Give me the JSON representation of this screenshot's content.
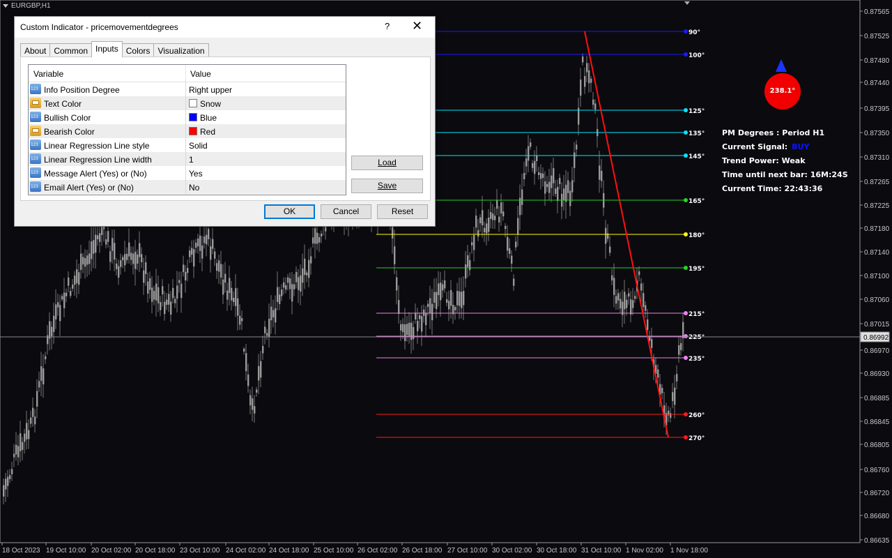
{
  "chart": {
    "symbol": "EURGBP,H1",
    "price_labels": [
      "0.87565",
      "0.87525",
      "0.87480",
      "0.87440",
      "0.87395",
      "0.87350",
      "0.87310",
      "0.87265",
      "0.87225",
      "0.87180",
      "0.87140",
      "0.87100",
      "0.87060",
      "0.87015",
      "0.86992",
      "0.86970",
      "0.86930",
      "0.86885",
      "0.86845",
      "0.86805",
      "0.86760",
      "0.86720",
      "0.86680",
      "0.86635"
    ],
    "current_price": "0.86992",
    "time_labels": [
      "18 Oct 2023",
      "19 Oct 10:00",
      "20 Oct 02:00",
      "20 Oct 18:00",
      "23 Oct 10:00",
      "24 Oct 02:00",
      "24 Oct 18:00",
      "25 Oct 10:00",
      "26 Oct 02:00",
      "26 Oct 18:00",
      "27 Oct 10:00",
      "30 Oct 02:00",
      "30 Oct 18:00",
      "31 Oct 10:00",
      "1 Nov 02:00",
      "1 Nov 18:00"
    ],
    "degree_levels": [
      {
        "label": "90°",
        "color": "#1a1aff"
      },
      {
        "label": "100°",
        "color": "#1a1aff"
      },
      {
        "label": "125°",
        "color": "#00e5ff"
      },
      {
        "label": "135°",
        "color": "#00e5ff"
      },
      {
        "label": "145°",
        "color": "#00e5ff"
      },
      {
        "label": "165°",
        "color": "#22d622"
      },
      {
        "label": "180°",
        "color": "#ffff00"
      },
      {
        "label": "195°",
        "color": "#22d622"
      },
      {
        "label": "215°",
        "color": "#ee82ee"
      },
      {
        "label": "225°",
        "color": "#ee82ee"
      },
      {
        "label": "235°",
        "color": "#ee82ee"
      },
      {
        "label": "260°",
        "color": "#ff1a1a"
      },
      {
        "label": "270°",
        "color": "#ff1a1a"
      }
    ],
    "compass_value": "238.1°",
    "info": {
      "line1": "PM Degrees : Period H1",
      "signal_label": "Current Signal:",
      "signal_value": "BUY",
      "trend": "Trend Power: Weak",
      "next_bar": "Time until next bar: 16M:24S",
      "current_time": "Current Time: 22:43:36"
    }
  },
  "dialog": {
    "title": "Custom Indicator - pricemovementdegrees",
    "help": "?",
    "close": "✕",
    "tabs": [
      "About",
      "Common",
      "Inputs",
      "Colors",
      "Visualization"
    ],
    "header_variable": "Variable",
    "header_value": "Value",
    "rows": [
      {
        "icon": "num",
        "variable": "Info Position Degree",
        "value": "Right upper"
      },
      {
        "icon": "color",
        "variable": "Text Color",
        "value": "Snow",
        "swatch": "#ffffff"
      },
      {
        "icon": "num",
        "variable": "Bullish Color",
        "value": "Blue",
        "swatch": "#0000ff"
      },
      {
        "icon": "color",
        "variable": "Bearish Color",
        "value": "Red",
        "swatch": "#ff0000"
      },
      {
        "icon": "num",
        "variable": "Linear Regression Line style",
        "value": "Solid"
      },
      {
        "icon": "num",
        "variable": "Linear Regression Line width",
        "value": "1"
      },
      {
        "icon": "num",
        "variable": "Message Alert (Yes) or (No)",
        "value": "Yes"
      },
      {
        "icon": "num",
        "variable": "Email Alert (Yes) or (No)",
        "value": "No"
      }
    ],
    "load": "Load",
    "save": "Save",
    "ok": "OK",
    "cancel": "Cancel",
    "reset": "Reset"
  }
}
